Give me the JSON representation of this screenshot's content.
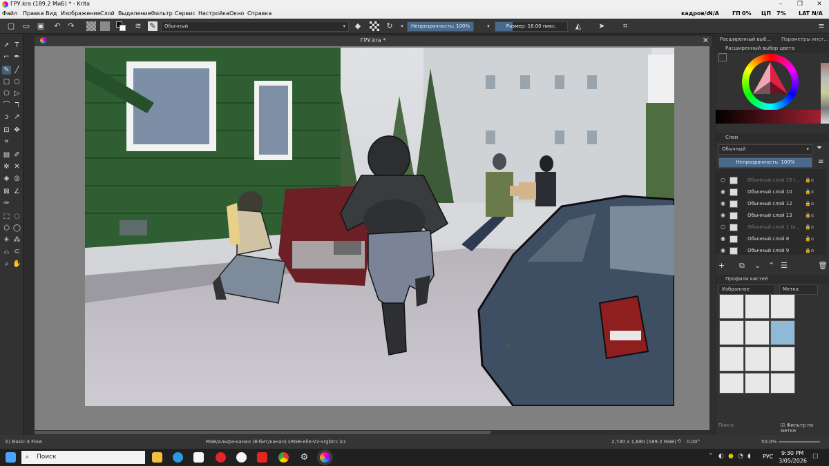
{
  "window": {
    "title": "ГРУ.kra (189.2 МиБ)  * - Krita"
  },
  "menu": [
    "Файл",
    "Правка",
    "Вид",
    "Изображение",
    "Слой",
    "Выделение",
    "Фильтр",
    "Сервис",
    "Настройка",
    "Окно",
    "Справка"
  ],
  "stats": {
    "fps_label": "кадров/с",
    "fps": "N/A",
    "gpu_label": "ГП",
    "gpu": "0%",
    "cpu_label": "ЦП",
    "cpu": "7%",
    "lat_label": "LAT",
    "lat": "N/A"
  },
  "toolbar": {
    "blend_mode": "Обычный",
    "opacity": "Непрозрачность: 100%",
    "size": "Размер: 16.00 пикс."
  },
  "canvas": {
    "tab_title": "ГРУ.kra *"
  },
  "dockers": {
    "color_tab": "Расширенный выб...",
    "params_tab": "Параметры инст...",
    "color_title": "Расширенный выбор цвета",
    "layers_title": "Слои",
    "blend": "Обычный",
    "opacity": "Непрозрачность: 100%",
    "brush_title": "Профили кистей",
    "brush_filter": "Избранное",
    "brush_tag": "Метка",
    "search_placeholder": "Поиск",
    "filter_by_tag": "Фильтр по метке"
  },
  "layers": [
    {
      "name": "Обычный слой 16 (...",
      "visible": false
    },
    {
      "name": "Обычный слой 10",
      "visible": true
    },
    {
      "name": "Обычный слой 12",
      "visible": true
    },
    {
      "name": "Обычный слой 13",
      "visible": true
    },
    {
      "name": "Обычный слой 1 (в...",
      "visible": false
    },
    {
      "name": "Обычный слой 8",
      "visible": true
    },
    {
      "name": "Обычный слой 9",
      "visible": true
    }
  ],
  "status": {
    "brush": "b) Basic-3 Flow",
    "color_profile": "RGB/альфа-канал (8-бит/канал)  sRGB-elle-V2-srgbtrc.icc",
    "doc_size": "2,730 x 1,680 (189.2 МиБ)",
    "rotation": "0.00°",
    "zoom": "50.0%"
  },
  "taskbar": {
    "search": "Поиск",
    "lang": "РУС",
    "time": "9:30 PM",
    "date": "3/05/2026"
  },
  "colors": {
    "accent": "#4a6a8c",
    "panel": "#323232"
  }
}
